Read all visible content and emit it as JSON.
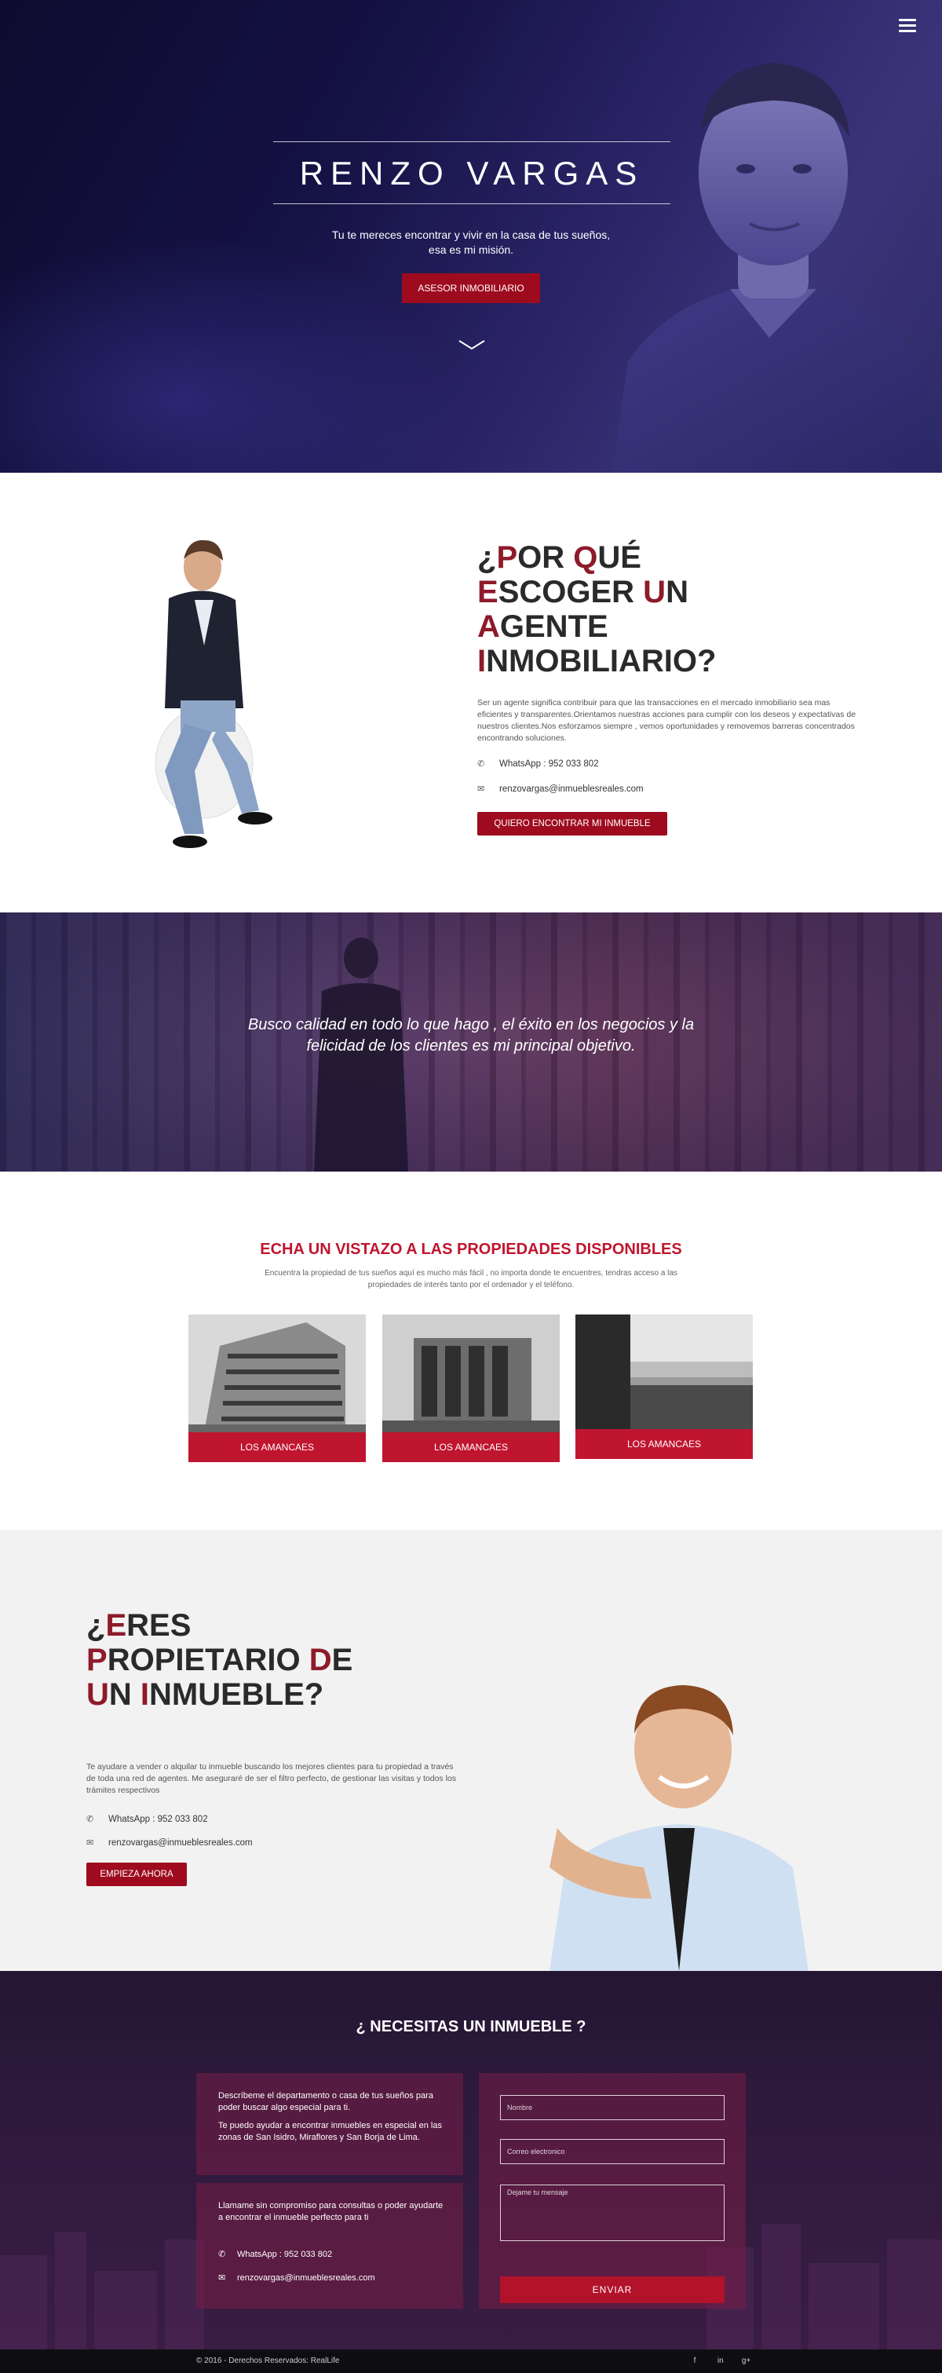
{
  "hero": {
    "title": "RENZO VARGAS",
    "subtitle": "Tu te mereces encontrar y vivir en la casa de tus sueños, esa es mi misión.",
    "button": "ASESOR INMOBILIARIO"
  },
  "why": {
    "title": "¿POR QUÉ ESCOGER UN AGENTE INMOBILIARIO?",
    "text": "Ser un agente significa contribuir para que las transacciones en el mercado inmobiliario sea mas eficientes y transparentes.Orientamos nuestras acciones para cumplir con los deseos y expectativas de nuestros clientes.Nos esforzamos siempre , vemos oportunidades y removemos barreras concentrados encontrando soluciones.",
    "whatsapp": "WhatsApp : 952 033 802",
    "email": "renzovargas@inmueblesreales.com",
    "button": "QUIERO ENCONTRAR MI INMUEBLE"
  },
  "quote": {
    "text": "Busco calidad en todo lo que hago , el éxito en los negocios y la felicidad de los clientes es mi principal objetivo."
  },
  "properties": {
    "title": "ECHA UN VISTAZO A LAS PROPIEDADES DISPONIBLES",
    "subtitle": "Encuentra la propiedad de tus sueños aquí es mucho más fácil , no importa donde te encuentres, tendras acceso a las propiedades de interés tanto por el ordenador y el teléfono.",
    "cards": [
      {
        "label": "LOS AMANCAES"
      },
      {
        "label": "LOS AMANCAES"
      },
      {
        "label": "LOS AMANCAES"
      }
    ]
  },
  "owner": {
    "title": "¿ERES PROPIETARIO DE UN INMUEBLE?",
    "text": "Te ayudare a vender o alquilar tu inmueble buscando los mejores clientes para tu propiedad a través de toda una red de agentes. Me aseguraré de ser el filtro perfecto, de gestionar las visitas y todos los trámites respectivos",
    "whatsapp": "WhatsApp : 952 033 802",
    "email": "renzovargas@inmueblesreales.com",
    "button": "EMPIEZA AHORA"
  },
  "contact": {
    "title": "¿ NECESITAS UN INMUEBLE ?",
    "box1_p1": "Descríbeme el departamento o casa de tus sueños para poder buscar algo especial para ti.",
    "box1_p2": "Te puedo ayudar a encontrar inmuebles en especial en las zonas de San Isidro, Miraflores y San Borja de Lima.",
    "box2_p1": "Llamame sin compromiso para consultas o poder ayudarte a encontrar el inmueble perfecto para ti",
    "whatsapp": "WhatsApp : 952 033 802",
    "email": "renzovargas@inmueblesreales.com",
    "form": {
      "name_placeholder": "Nombre",
      "email_placeholder": "Correo electronico",
      "message_placeholder": "Dejame tu mensaje",
      "send": "ENVIAR"
    }
  },
  "footer": {
    "copyright": "© 2016 - Derechos Reservados: RealLife",
    "social": [
      "f",
      "in",
      "g+"
    ]
  },
  "colors": {
    "accent": "#c0152f",
    "accent_dark": "#9e0b1f",
    "hero_bg": "#151245"
  }
}
